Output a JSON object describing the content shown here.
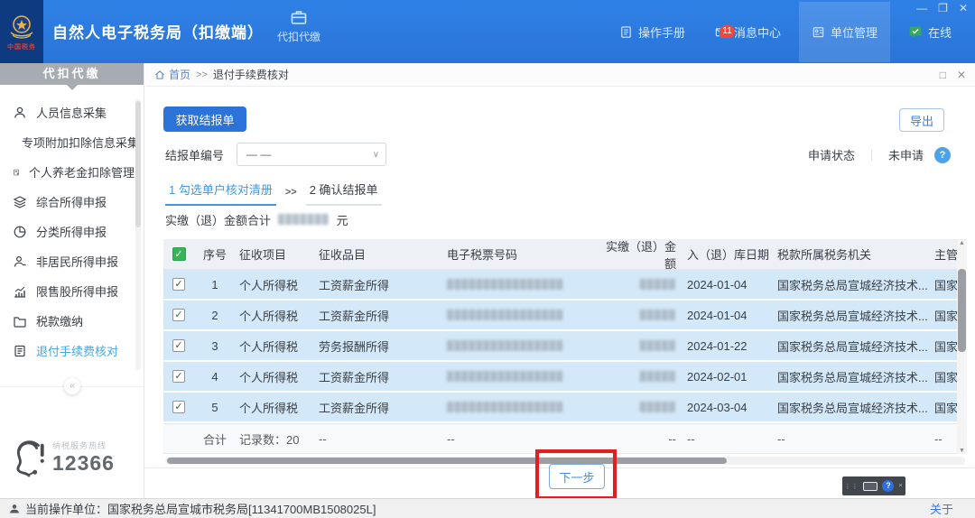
{
  "window_controls": {
    "minimize": "—",
    "restore": "❐",
    "close": "✕"
  },
  "header": {
    "title": "自然人电子税务局（扣缴端）",
    "logo_caption": "中国税务",
    "nav_tab": {
      "label": "代扣代缴"
    },
    "links": [
      {
        "label": "操作手册"
      },
      {
        "label": "消息中心",
        "badge": "11"
      },
      {
        "label": "单位管理"
      },
      {
        "label": "在线"
      }
    ]
  },
  "sidebar": {
    "header": "代扣代缴",
    "items": [
      {
        "label": "人员信息采集"
      },
      {
        "label": "专项附加扣除信息采集"
      },
      {
        "label": "个人养老金扣除管理"
      },
      {
        "label": "综合所得申报"
      },
      {
        "label": "分类所得申报"
      },
      {
        "label": "非居民所得申报"
      },
      {
        "label": "限售股所得申报"
      },
      {
        "label": "税款缴纳"
      },
      {
        "label": "退付手续费核对"
      }
    ],
    "collapse_glyph": "«",
    "hotline": {
      "caption": "纳税服务热线",
      "number": "12366"
    }
  },
  "breadcrumb": {
    "home": "首页",
    "separator": ">>",
    "current": "退付手续费核对"
  },
  "panel_controls": {
    "maximize": "□",
    "close": "✕"
  },
  "toolbar": {
    "fetch_button": "获取结报单",
    "export_button": "导出",
    "report_label": "结报单编号",
    "report_value": "— —",
    "chevron": "∨",
    "status_label": "申请状态",
    "status_divider": "｜",
    "status_value": "未申请",
    "help_glyph": "?"
  },
  "steps": {
    "step1": "1 勾选单户核对清册",
    "separator": ">>",
    "step2": "2 确认结报单"
  },
  "summary": {
    "label": "实缴（退）金额合计",
    "masked_value": "███████",
    "unit": "元"
  },
  "table": {
    "check_glyph": "✓",
    "headers": [
      "序号",
      "征收项目",
      "征收品目",
      "电子税票号码",
      "实缴（退）金额",
      "入（退）库日期",
      "税款所属税务机关",
      "主管"
    ],
    "rows": [
      {
        "seq": "1",
        "item": "个人所得税",
        "category": "工资薪金所得",
        "eticket_masked": "████████████████",
        "amount_masked": "█████",
        "date": "2024-01-04",
        "authority": "国家税务总局宣城经济技术...",
        "supervisor": "国家"
      },
      {
        "seq": "2",
        "item": "个人所得税",
        "category": "工资薪金所得",
        "eticket_masked": "████████████████",
        "amount_masked": "█████",
        "date": "2024-01-04",
        "authority": "国家税务总局宣城经济技术...",
        "supervisor": "国家"
      },
      {
        "seq": "3",
        "item": "个人所得税",
        "category": "劳务报酬所得",
        "eticket_masked": "████████████████",
        "amount_masked": "█████",
        "date": "2024-01-22",
        "authority": "国家税务总局宣城经济技术...",
        "supervisor": "国家"
      },
      {
        "seq": "4",
        "item": "个人所得税",
        "category": "工资薪金所得",
        "eticket_masked": "████████████████",
        "amount_masked": "█████",
        "date": "2024-02-01",
        "authority": "国家税务总局宣城经济技术...",
        "supervisor": "国家"
      },
      {
        "seq": "5",
        "item": "个人所得税",
        "category": "工资薪金所得",
        "eticket_masked": "████████████████",
        "amount_masked": "█████",
        "date": "2024-03-04",
        "authority": "国家税务总局宣城经济技术...",
        "supervisor": "国家"
      }
    ],
    "footer": {
      "total_label": "合计",
      "record_count": "记录数：20",
      "dash": "--"
    }
  },
  "next_button": "下一步",
  "statusbar": {
    "operator": "当前操作单位：国家税务总局宣城市税务局[11341700MB1508025L]",
    "about": "关于"
  }
}
